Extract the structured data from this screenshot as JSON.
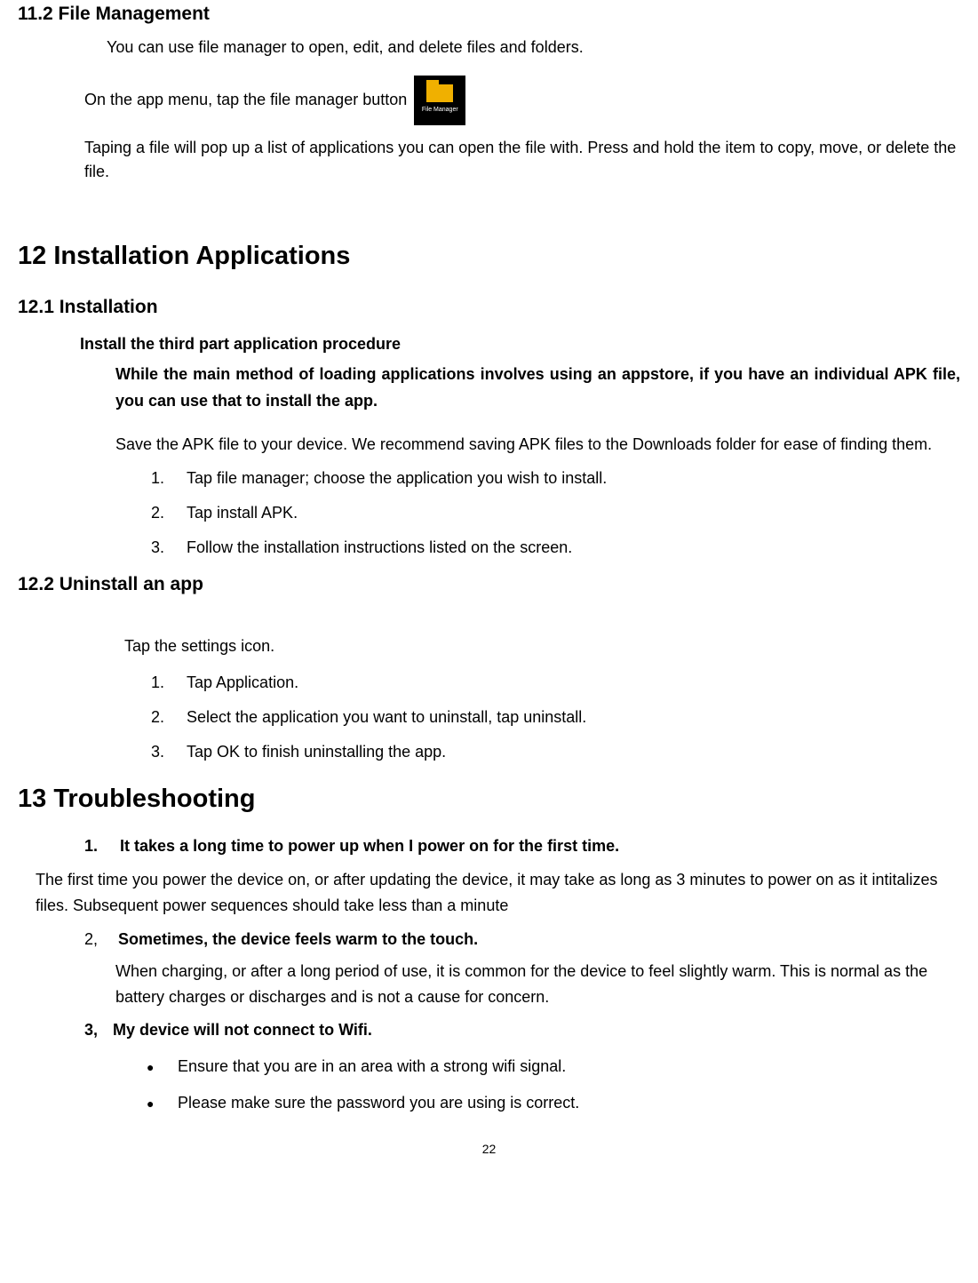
{
  "section_11_2": {
    "heading": "11.2 File Management",
    "p1": "You can use file manager to open, edit, and delete files and folders.",
    "p2_pre": "On the app menu, tap the file manager button",
    "icon_label": "File Manager",
    "p3": "Taping a file will pop up a list of applications you can open the file with. Press and hold the item to copy, move, or delete the file."
  },
  "section_12": {
    "heading": "12    Installation Applications",
    "sub_12_1": {
      "heading": "12.1    Installation",
      "bold_sub": "Install the third part application procedure",
      "bold_para": "While the main method of loading applications involves using an appstore, if you have an individual APK file, you can use that to install the app.",
      "para": "Save the APK file to your device. We recommend saving APK files to the Downloads folder for ease of finding them.",
      "steps": [
        {
          "n": "1.",
          "t": "Tap file manager; choose the application you wish to install."
        },
        {
          "n": "2.",
          "t": "Tap install APK."
        },
        {
          "n": "3.",
          "t": "Follow the installation instructions listed on the screen."
        }
      ]
    },
    "sub_12_2": {
      "heading": "12.2      Uninstall an app",
      "lead": "Tap the settings icon.",
      "steps": [
        {
          "n": "1.",
          "t": "Tap Application."
        },
        {
          "n": "2.",
          "t": "Select the application you want to uninstall, tap uninstall."
        },
        {
          "n": "3.",
          "t": "Tap OK to finish uninstalling the app."
        }
      ]
    }
  },
  "section_13": {
    "heading": "13   Troubleshooting",
    "item1": {
      "num": "1.",
      "title": "It takes a long time to power up when I power on for the first time.",
      "body": "The first time you power the device on, or after updating the device, it may take as long as 3 minutes to power on as it intitalizes files. Subsequent power sequences should take less than a minute"
    },
    "item2": {
      "num": "2,",
      "title": "Sometimes, the device feels warm to the touch.",
      "body": "When charging, or after a long period of use, it is common for the device to feel slightly warm. This is normal as the battery charges or discharges and is not a cause for concern."
    },
    "item3": {
      "num": "3,",
      "title": "My device will not connect to Wifi.",
      "bullets": [
        "Ensure that you are in an area with a strong wifi signal.",
        "Please make sure the password you are using is correct."
      ]
    }
  },
  "page_number": "22"
}
